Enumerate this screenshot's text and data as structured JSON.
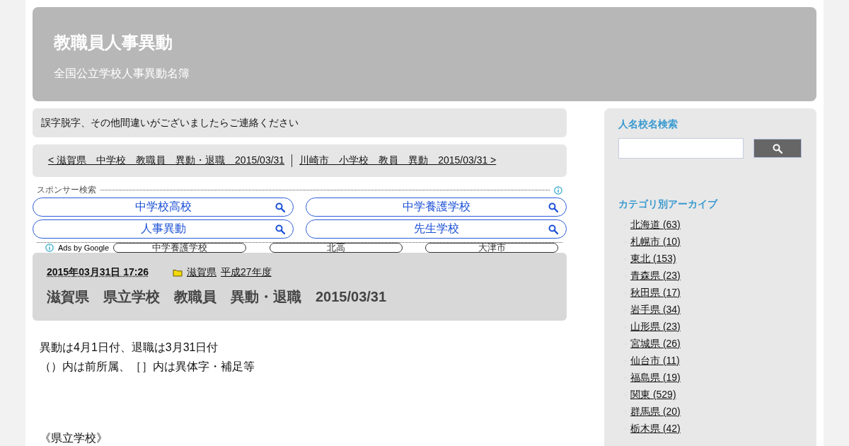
{
  "header": {
    "title": "教職員人事異動",
    "subtitle": "全国公立学校人事異動名簿"
  },
  "notice": "誤字脱字、その他間違いがございましたらご連絡ください",
  "post_nav": {
    "previous": "< 滋賀県　中学校　教職員　異動・退職　2015/03/31",
    "next": "川崎市　小学校　教員　異動　2015/03/31 >"
  },
  "sponsor_search": {
    "label": "スポンサー検索",
    "buttons": [
      "中学校高校",
      "中学養護学校",
      "人事異動",
      "先生学校"
    ],
    "ads_label": "Ads by Google",
    "related": [
      "中学養護学校",
      "北高",
      "大津市"
    ]
  },
  "post": {
    "date": "2015年03月31日 17:26",
    "categories": [
      "滋賀県",
      "平成27年度"
    ],
    "title": "滋賀県　県立学校　教職員　異動・退職　2015/03/31",
    "body": [
      "異動は4月1日付、退職は3月31日付",
      "（）内は前所属、［］内は異体字・補足等"
    ],
    "section_heading": "《県立学校》"
  },
  "sidebar": {
    "search_heading": "人名校名検索",
    "archive_heading": "カテゴリ別アーカイブ",
    "categories": [
      "北海道 (63)",
      "札幌市 (10)",
      "東北 (153)",
      "青森県 (23)",
      "秋田県 (17)",
      "岩手県 (34)",
      "山形県 (23)",
      "宮城県 (26)",
      "仙台市 (11)",
      "福島県 (19)",
      "関東 (529)",
      "群馬県 (20)",
      "栃木県 (42)"
    ]
  }
}
